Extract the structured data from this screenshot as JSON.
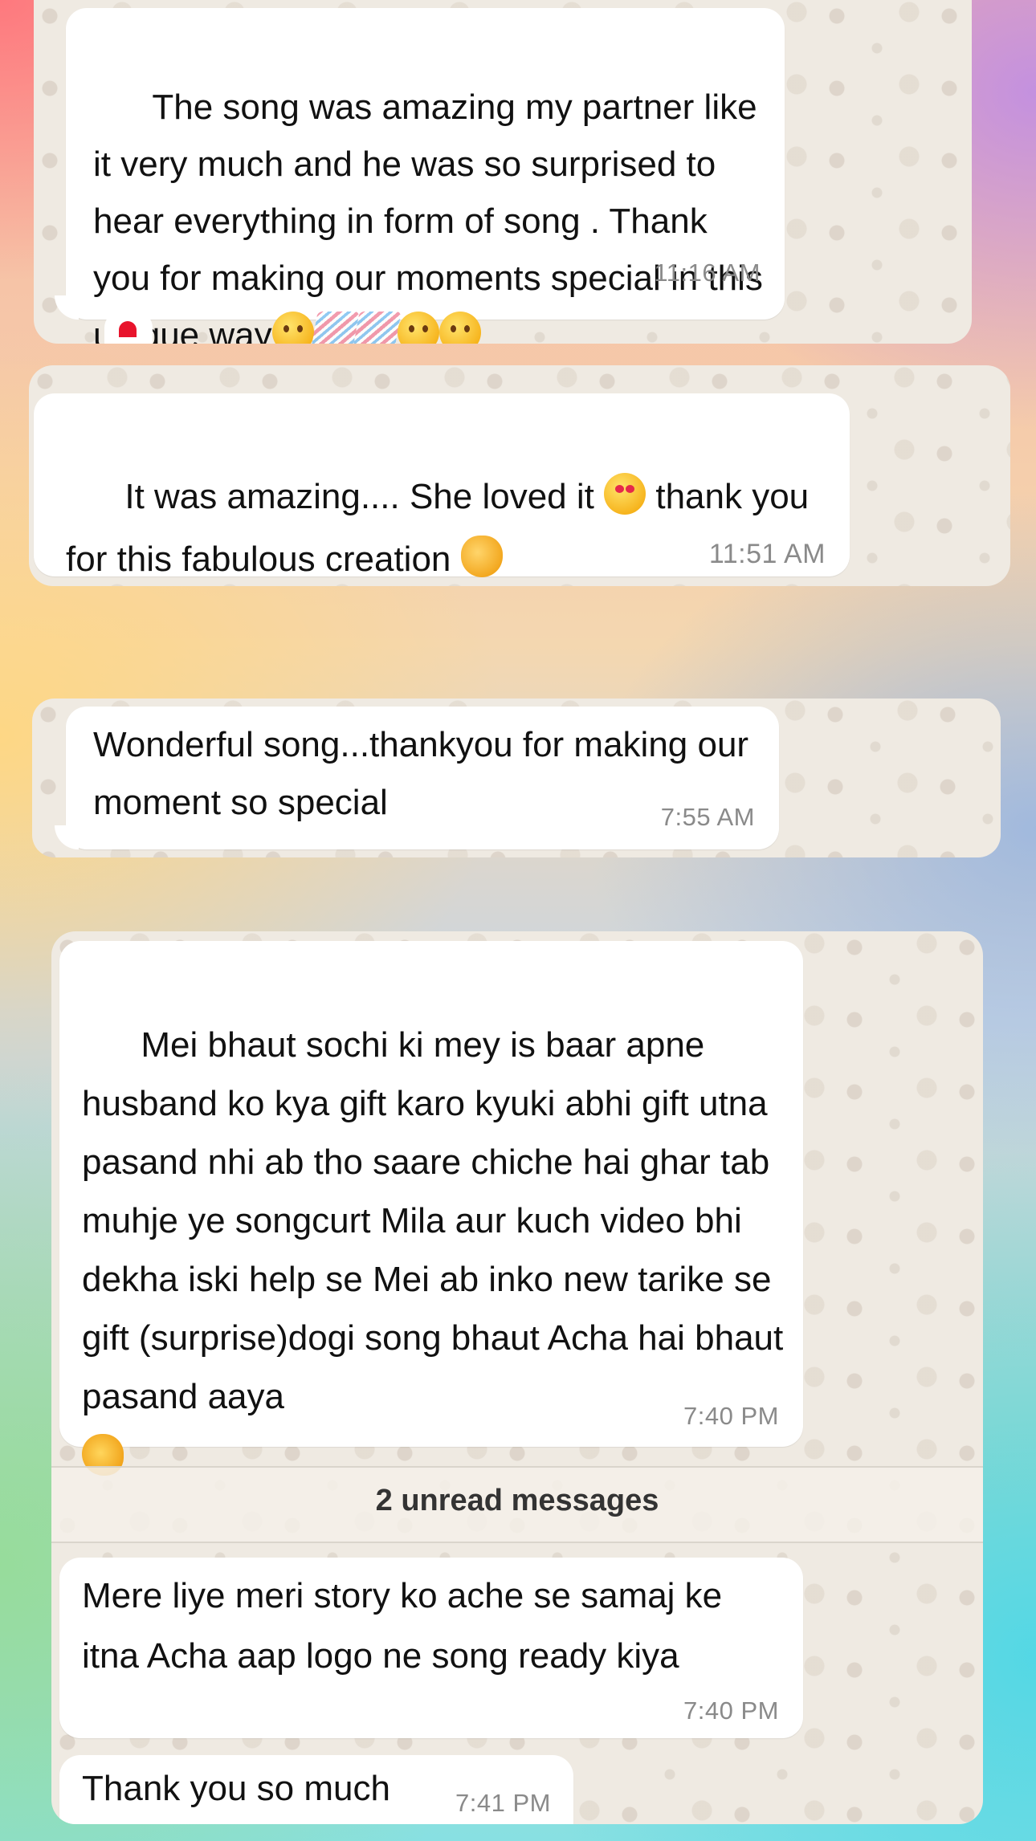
{
  "messages": [
    {
      "text": "The song was amazing my partner like it very much and he was so surprised to hear everything in form of song . Thank you for making our moments special in this unique way",
      "emojis": [
        "smiling-face",
        "party-popper",
        "party-popper",
        "partying-face",
        "partying-face"
      ],
      "time": "11:16 AM",
      "reaction": "heart"
    },
    {
      "text_part1": "It was amazing.... She loved it",
      "emoji1": "smiling-face-with-hearts",
      "text_part2": "thank you for this fabulous creation",
      "emoji2": "heart-eyes-cat",
      "time": "11:51 AM"
    },
    {
      "text": "Wonderful song...thankyou for making our moment so special",
      "time": "7:55 AM"
    },
    {
      "text": "Mei bhaut sochi ki mey is baar apne husband ko kya gift karo kyuki abhi gift utna pasand nhi ab tho saare chiche hai ghar tab muhje ye songcurt Mila aur kuch video bhi dekha iski help se Mei ab inko new tarike se gift (surprise)dogi song bhaut Acha hai bhaut pasand aaya",
      "emoji": "ok-hand",
      "time": "7:40 PM"
    },
    {
      "text": "Mere liye meri story ko ache se samaj ke itna Acha aap logo ne song ready kiya",
      "time": "7:40 PM"
    },
    {
      "text": "Thank you so much",
      "time": "7:41 PM"
    }
  ],
  "unread_divider": "2 unread messages"
}
